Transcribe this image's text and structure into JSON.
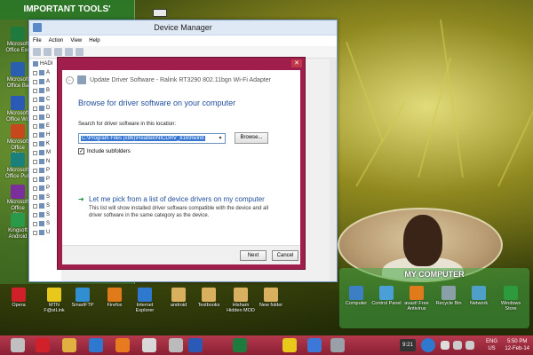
{
  "gadget_tools": {
    "title": "IMPORTANT TOOLS'",
    "items": [
      {
        "label": "Microsoft Office Exc",
        "color": "#1f7a3e"
      },
      {
        "label": "Microsoft Office Ba",
        "color": "#2a5fb0"
      },
      {
        "label": "Microsoft Office Wo",
        "color": "#2b5ab6"
      },
      {
        "label": "Microsoft Office Pow",
        "color": "#c8481e"
      },
      {
        "label": "Microsoft Office Pub",
        "color": "#1b7f7a"
      },
      {
        "label": "Microsoft Office One",
        "color": "#7a2f9a"
      },
      {
        "label": "Kingsoft Android",
        "color": "#2a9a4a"
      }
    ]
  },
  "device_manager": {
    "title": "Device Manager",
    "menu": [
      "File",
      "Action",
      "View",
      "Help"
    ],
    "tree_root": "HADI",
    "tree_items": [
      "A",
      "A",
      "B",
      "C",
      "D",
      "D",
      "E",
      "H",
      "K",
      "M",
      "N",
      "P",
      "P",
      "P",
      "S",
      "S",
      "S",
      "S",
      "U"
    ]
  },
  "dialog": {
    "header": "Update Driver Software - Ralink RT3290 802.11bgn Wi-Fi Adapter",
    "close": "✕",
    "back": "←",
    "title": "Browse for driver software on your computer",
    "search_label": "Search for driver software in this location:",
    "path_value": "C:\\Program Files (x86)\\Realtek\\NICDRV_8169\\win8",
    "browse": "Browse...",
    "include_subfolders": "Include subfolders",
    "pick_title": "Let me pick from a list of device drivers on my computer",
    "pick_desc": "This list will show installed driver software compatible with the device and all driver software in the same category as the device.",
    "next": "Next",
    "cancel": "Cancel"
  },
  "my_computer": {
    "title": "MY COMPUTER",
    "items": [
      {
        "label": "Computer",
        "color": "#3d7fc4"
      },
      {
        "label": "Control Panel",
        "color": "#4aa0d6"
      },
      {
        "label": "avast! Free Antivirus",
        "color": "#e07a1a"
      },
      {
        "label": "Recycle Bin",
        "color": "#8aa0a8"
      },
      {
        "label": "Network",
        "color": "#4fa0c8"
      },
      {
        "label": "Windows Store",
        "color": "#2e9a3e"
      }
    ]
  },
  "desktop_icons": [
    {
      "label": "Opera",
      "color": "#d0202a"
    },
    {
      "label": "MTN F@stLink",
      "color": "#e8c81a"
    },
    {
      "label": "SmartFTP",
      "color": "#2f8fd0"
    },
    {
      "label": "Firefox",
      "color": "#e07a1a"
    },
    {
      "label": "Internet Explorer",
      "color": "#2f78d0"
    },
    {
      "label": "android",
      "color": "#d8b060"
    },
    {
      "label": "Textbooks",
      "color": "#d8b060"
    },
    {
      "label": "Hisham Hidden MOD",
      "color": "#d8b060"
    },
    {
      "label": "New folder",
      "color": "#d8b060"
    }
  ],
  "taskbar": {
    "icons": [
      {
        "name": "start-icon",
        "color": "#c0c0c0"
      },
      {
        "name": "opera-icon",
        "color": "#d0202a"
      },
      {
        "name": "explorer-folder-icon",
        "color": "#e0b040"
      },
      {
        "name": "ie-icon",
        "color": "#2f78d0"
      },
      {
        "name": "media-player-icon",
        "color": "#e87a20"
      },
      {
        "name": "chrome-icon",
        "color": "#d8d8d8"
      },
      {
        "name": "sound-icon",
        "color": "#bbbbbb"
      },
      {
        "name": "word-icon",
        "color": "#2b5ab6"
      },
      {
        "name": "excel-icon",
        "color": "#1f7a3e"
      },
      {
        "name": "pes-icon",
        "color": "#e8c81a"
      },
      {
        "name": "cloud-icon",
        "color": "#3c78d8"
      },
      {
        "name": "device-manager-icon",
        "color": "#9aa0a8"
      }
    ],
    "tray_badge": "9:21",
    "lang": "ENG",
    "region": "US",
    "time": "5:50 PM",
    "date": "12-Feb-14"
  }
}
